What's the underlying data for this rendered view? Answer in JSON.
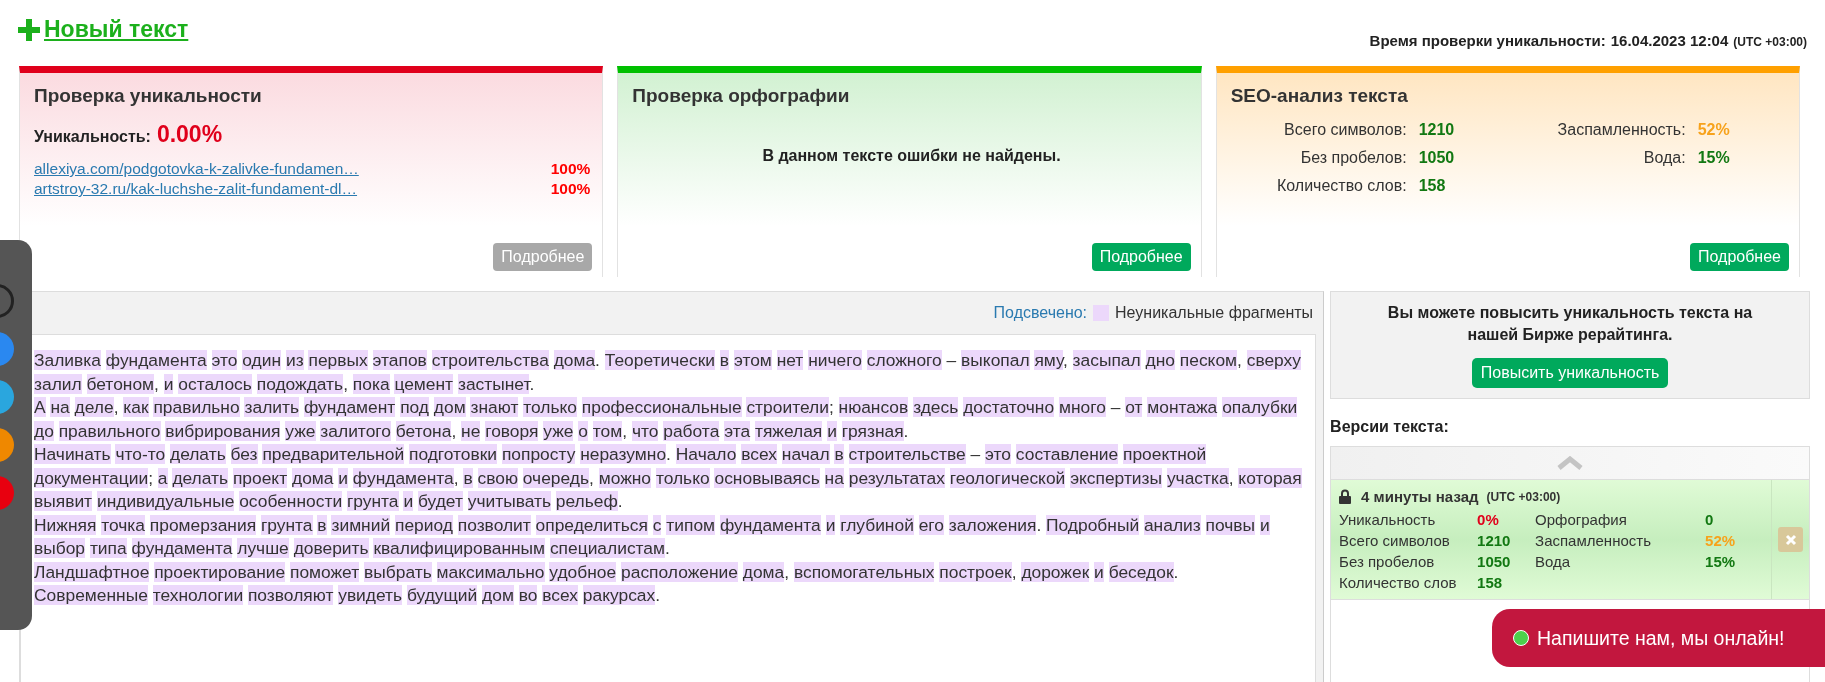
{
  "header": {
    "new_text_link": "Новый текст",
    "check_time_label": "Время проверки уникальности:",
    "check_time": "16.04.2023 12:04",
    "timezone": "(UTC +03:00)"
  },
  "cards": [
    {
      "kind": "uniqueness",
      "title": "Проверка уникальности",
      "score_label": "Уникальность:",
      "score": "0.00%",
      "sources": [
        {
          "url": "allexiya.com/podgotovka-k-zalivke-fundamen…",
          "match": "100%"
        },
        {
          "url": "artstroy-32.ru/kak-luchshe-zalit-fundament-dl…",
          "match": "100%"
        }
      ],
      "button": {
        "label": "Подробнее",
        "disabled": true
      }
    },
    {
      "kind": "spelling",
      "title": "Проверка орфографии",
      "message": "В данном тексте ошибки не найдены.",
      "button": {
        "label": "Подробнее",
        "disabled": false
      }
    },
    {
      "kind": "seo",
      "title": "SEO-анализ текста",
      "metrics_left": [
        {
          "label": "Всего символов:",
          "value": "1210",
          "color": "#127812"
        },
        {
          "label": "Без пробелов:",
          "value": "1050",
          "color": "#127812"
        },
        {
          "label": "Количество слов:",
          "value": "158",
          "color": "#127812"
        }
      ],
      "metrics_right": [
        {
          "label": "Заспамленность:",
          "value": "52%",
          "color": "#f7a21b"
        },
        {
          "label": "Вода:",
          "value": "15%",
          "color": "#127812"
        }
      ],
      "button": {
        "label": "Подробнее",
        "disabled": false
      }
    }
  ],
  "text_panel": {
    "legend_label": "Подсвечено:",
    "legend_text": "Неуникальные фрагменты",
    "paragraphs": [
      {
        "text": "Заливка фундамента это один из первых этапов строительства дома. Теоретически в этом нет ничего сложного – выкопал яму, засыпал дно песком, сверху залил бетоном, и осталось подождать, пока цемент застынет.",
        "non_unique": true
      },
      {
        "text": "А на деле, как правильно залить фундамент под дом знают только профессиональные строители; нюансов здесь достаточно много – от монтажа опалубки до правильного вибрирования уже залитого бетона, не говоря уже о том, что работа эта тяжелая и грязная.",
        "non_unique": true
      },
      {
        "text": "Начинать что-то делать без предварительной подготовки попросту неразумно. Начало всех начал в строительстве – это составление проектной документации; а делать проект дома и фундамента, в свою очередь, можно только основываясь на результатах геологической экспертизы участка, которая выявит индивидуальные особенности грунта и будет учитывать рельеф.",
        "non_unique": true
      },
      {
        "text": "Нижняя точка промерзания грунта в зимний период позволит определиться с типом фундамента и глубиной его заложения. Подробный анализ почвы и выбор типа фундамента лучше доверить квалифицированным специалистам.",
        "non_unique": true
      },
      {
        "text": "Ландшафтное проектирование поможет выбрать максимально удобное расположение дома, вспомогательных построек, дорожек и беседок.",
        "non_unique": true
      },
      {
        "text": "Современные технологии позволяют увидеть будущий дом во всех ракурсах.",
        "non_unique": true
      }
    ]
  },
  "promo": {
    "text": "Вы можете повысить уникальность текста на нашей Бирже рерайтинга.",
    "button": "Повысить уникальность"
  },
  "versions": {
    "title": "Версии текста:",
    "items": [
      {
        "time": "4 минуты назад",
        "timezone": "(UTC +03:00)",
        "stats_left": [
          {
            "label": "Уникальность",
            "value": "0%",
            "color": "#e0001b"
          },
          {
            "label": "Всего символов",
            "value": "1210",
            "color": "#127812"
          },
          {
            "label": "Без пробелов",
            "value": "1050",
            "color": "#127812"
          },
          {
            "label": "Количество слов",
            "value": "158",
            "color": "#127812"
          }
        ],
        "stats_right": [
          {
            "label": "Орфография",
            "value": "0",
            "color": "#127812"
          },
          {
            "label": "Заспамленность",
            "value": "52%",
            "color": "#f7a21b"
          },
          {
            "label": "Вода",
            "value": "15%",
            "color": "#127812"
          }
        ]
      }
    ]
  },
  "chat": {
    "text": "Напишите нам, мы онлайн!",
    "online": true
  }
}
